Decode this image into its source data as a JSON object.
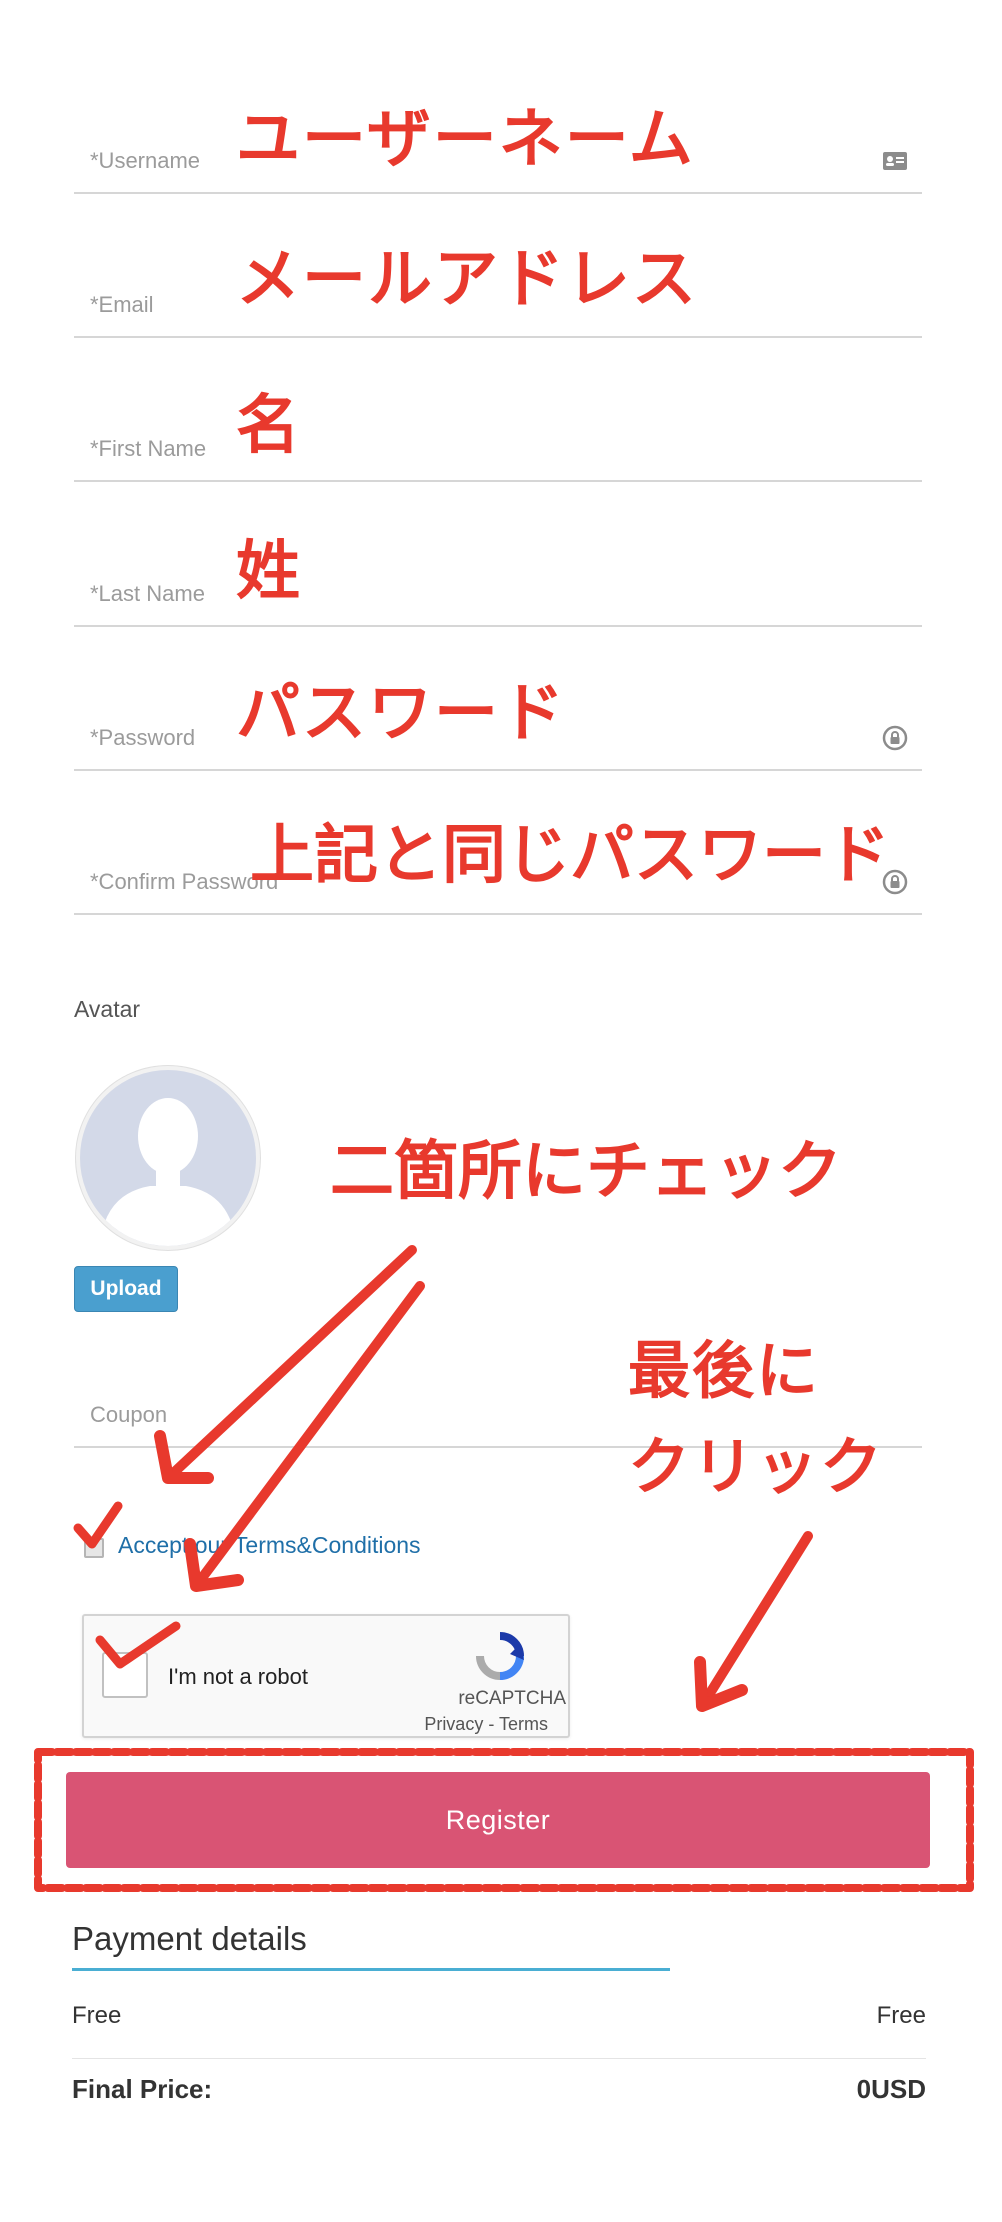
{
  "form": {
    "username_label": "*Username",
    "email_label": "*Email",
    "first_name_label": "*First Name",
    "last_name_label": "*Last Name",
    "password_label": "*Password",
    "confirm_password_label": "*Confirm Password",
    "avatar_label": "Avatar",
    "upload_label": "Upload",
    "coupon_placeholder": "Coupon",
    "terms_label": "Accept our Terms&Conditions"
  },
  "recaptcha": {
    "checkbox_label": "I'm not a robot",
    "brand": "reCAPTCHA",
    "privacy_terms": "Privacy - Terms"
  },
  "register_label": "Register",
  "payment": {
    "title": "Payment details",
    "rows": [
      {
        "label": "Free",
        "value": "Free"
      },
      {
        "label": "Final Price:",
        "value": "0USD"
      }
    ]
  },
  "annotations": {
    "username": "ユーザーネーム",
    "email": "メールアドレス",
    "first_name": "名",
    "last_name": "姓",
    "password": "パスワード",
    "confirm_password": "上記と同じパスワード",
    "check_two": "二箇所にチェック",
    "click_last_1": "最後に",
    "click_last_2": "クリック"
  },
  "colors": {
    "annotation": "#e8392d",
    "register_button": "#d95474",
    "upload_button": "#4a9fcf",
    "link": "#1f6fa8",
    "payment_underline": "#4aaed3"
  },
  "icons": {
    "username": "id-card-icon",
    "password": "lock-icon",
    "confirm_password": "lock-icon"
  }
}
